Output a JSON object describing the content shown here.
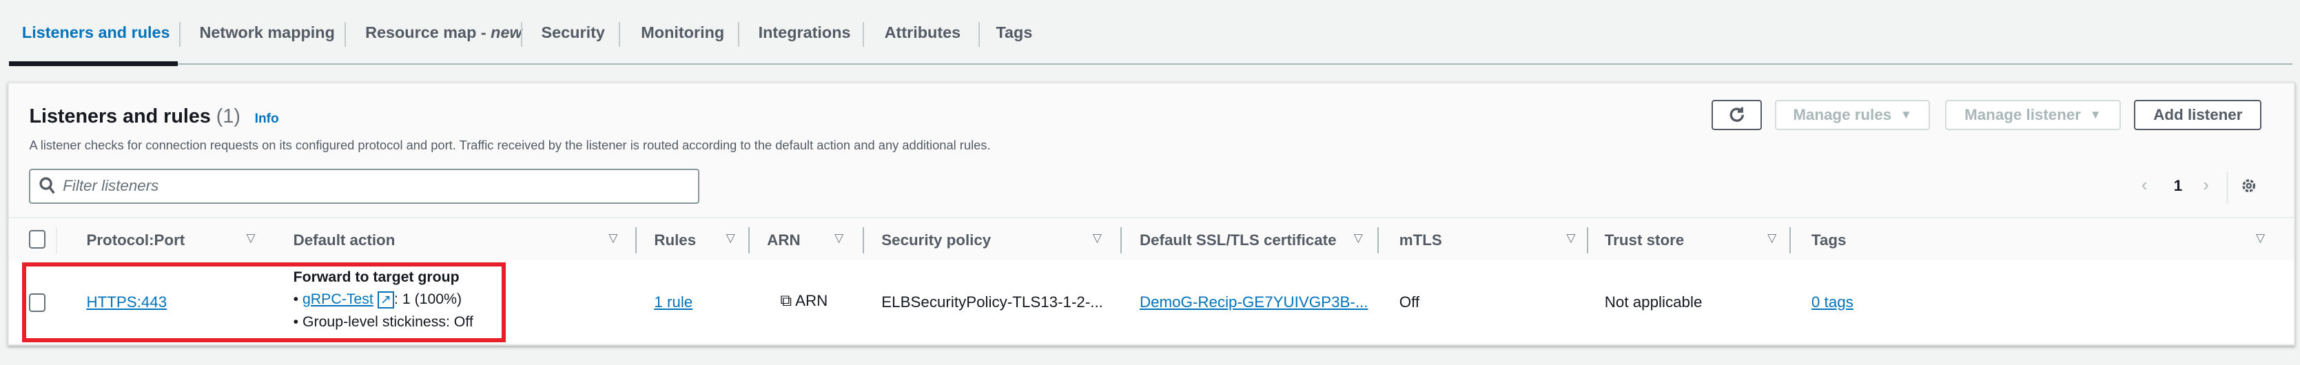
{
  "tabs": [
    {
      "label": "Listeners and rules",
      "active": true
    },
    {
      "label": "Network mapping"
    },
    {
      "label": "Resource map - ",
      "suffix": "new"
    },
    {
      "label": "Security"
    },
    {
      "label": "Monitoring"
    },
    {
      "label": "Integrations"
    },
    {
      "label": "Attributes"
    },
    {
      "label": "Tags"
    }
  ],
  "panel": {
    "title": "Listeners and rules",
    "count": "(1)",
    "info": "Info",
    "description": "A listener checks for connection requests on its configured protocol and port. Traffic received by the listener is routed according to the default action and any additional rules.",
    "filter_placeholder": "Filter listeners",
    "buttons": {
      "refresh": "refresh-icon",
      "manage_rules": "Manage rules",
      "manage_listener": "Manage listener",
      "add_listener": "Add listener"
    },
    "pagination": {
      "page": "1"
    }
  },
  "table": {
    "columns": [
      "Protocol:Port",
      "Default action",
      "Rules",
      "ARN",
      "Security policy",
      "Default SSL/TLS certificate",
      "mTLS",
      "Trust store",
      "Tags"
    ],
    "rows": [
      {
        "protocol_port": "HTTPS:443",
        "default_action": {
          "title": "Forward to target group",
          "target": "gRPC-Test",
          "target_weight": ": 1 (100%)",
          "stickiness": "Group-level stickiness: Off"
        },
        "rules": "1 rule",
        "arn": "ARN",
        "security_policy": "ELBSecurityPolicy-TLS13-1-2-...",
        "certificate": "DemoG-Recip-GE7YUIVGP3B-...",
        "mtls": "Off",
        "trust_store": "Not applicable",
        "tags": "0 tags"
      }
    ]
  },
  "colors": {
    "accent": "#0073bb",
    "highlight": "#e8202a"
  }
}
